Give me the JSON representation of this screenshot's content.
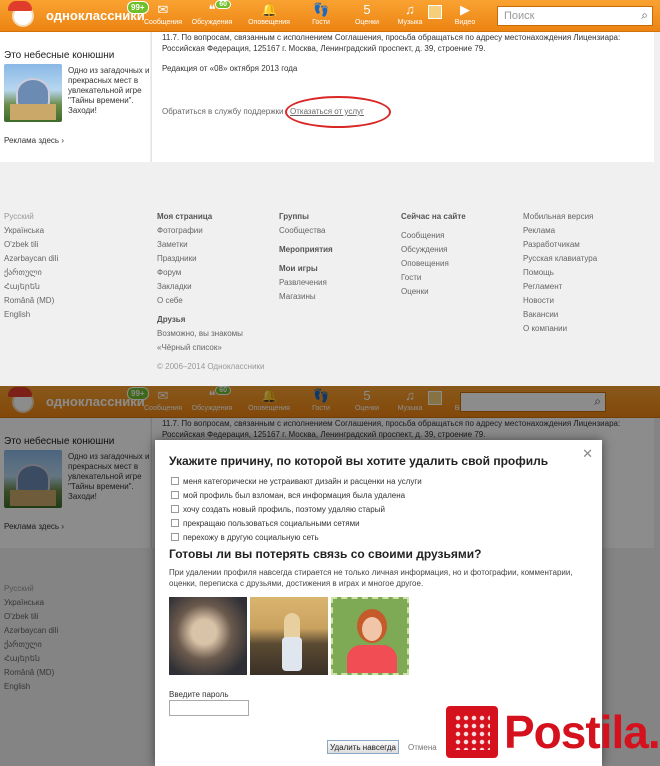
{
  "topbar": {
    "brand": "одноклассники",
    "count_badge": "99+",
    "nav": [
      {
        "label": "Сообщения",
        "icon": "envelope-icon",
        "glyph": "✉",
        "badge": ""
      },
      {
        "label": "Обсуждения",
        "icon": "discussions-icon",
        "glyph": "❝",
        "badge": "60"
      },
      {
        "label": "Оповещения",
        "icon": "bell-icon",
        "glyph": "🔔",
        "badge": ""
      },
      {
        "label": "Гости",
        "icon": "footprints-icon",
        "glyph": "👣",
        "badge": ""
      },
      {
        "label": "Оценки",
        "icon": "rating-icon",
        "glyph": "5",
        "badge": ""
      },
      {
        "label": "Музыка",
        "icon": "music-icon",
        "glyph": "♫",
        "badge": ""
      },
      {
        "label": "Видео",
        "icon": "video-icon",
        "glyph": "▶",
        "badge": ""
      }
    ],
    "search_placeholder": "Поиск"
  },
  "ad": {
    "title": "Это небесные конюшни",
    "text": "Одно из загадочных и прекрасных мест в увлекательной игре \"Тайны времени\". Заходи!",
    "here": "Реклама здесь ›"
  },
  "main": {
    "legal": "11.7. По вопросам, связанным с исполнением Соглашения, просьба обращаться по адресу местонахождения Лицензиара: Российская Федерация, 125167 г. Москва, Ленинградский проспект, д. 39, строение 79.",
    "edition": "Редакция от «08» октября 2013 года",
    "support_link": "Обратиться в службу поддержки",
    "refuse_link": "Отказаться от услуг"
  },
  "footer": {
    "languages": [
      "Русский",
      "Українська",
      "O'zbek tili",
      "Azərbaycan dili",
      "ქართული",
      "Հայերեն",
      "Română (MD)",
      "English"
    ],
    "col2": {
      "h1": "Моя страница",
      "items1": [
        "Фотографии",
        "Заметки",
        "Праздники",
        "Форум",
        "Закладки",
        "О себе"
      ],
      "h2": "Друзья",
      "items2": [
        "Возможно, вы знакомы",
        "«Чёрный список»"
      ]
    },
    "col3": {
      "h1": "Группы",
      "items1": [
        "Сообщества"
      ],
      "h2": "Мероприятия",
      "h3": "Мои игры",
      "items3": [
        "Развлечения",
        "Магазины"
      ]
    },
    "col4": {
      "h1": "Сейчас на сайте",
      "items1": [
        "Сообщения",
        "Обсуждения",
        "Оповещения",
        "Гости",
        "Оценки"
      ]
    },
    "col5": {
      "items": [
        "Мобильная версия",
        "Реклама",
        "Разработчикам",
        "Русская клавиатура",
        "Помощь",
        "Регламент",
        "Новости",
        "Вакансии",
        "О компании"
      ]
    },
    "copyright": "© 2006–2014 Одноклассники"
  },
  "dialog": {
    "title": "Укажите причину, по которой вы хотите удалить свой профиль",
    "reasons": [
      "меня категорически не устраивают дизайн и расценки на услуги",
      "мой профиль был взломан, вся информация была удалена",
      "хочу создать новый профиль, поэтому удаляю старый",
      "прекращаю пользоваться социальными сетями",
      "перехожу в другую социальную сеть"
    ],
    "question": "Готовы ли вы потерять связь со своими друзьями?",
    "description": "При удалении профиля навсегда стирается не только личная информация, но и фотографии, комментарии, оценки, переписка с друзьями, достижения в играх и многое другое.",
    "password_label": "Введите пароль",
    "delete_button": "Удалить навсегда",
    "cancel": "Отмена"
  },
  "watermark": {
    "text": "Postila.ru"
  },
  "colors": {
    "accent": "#ee8208",
    "highlight_oval": "#d92626",
    "watermark": "#d6111e"
  }
}
